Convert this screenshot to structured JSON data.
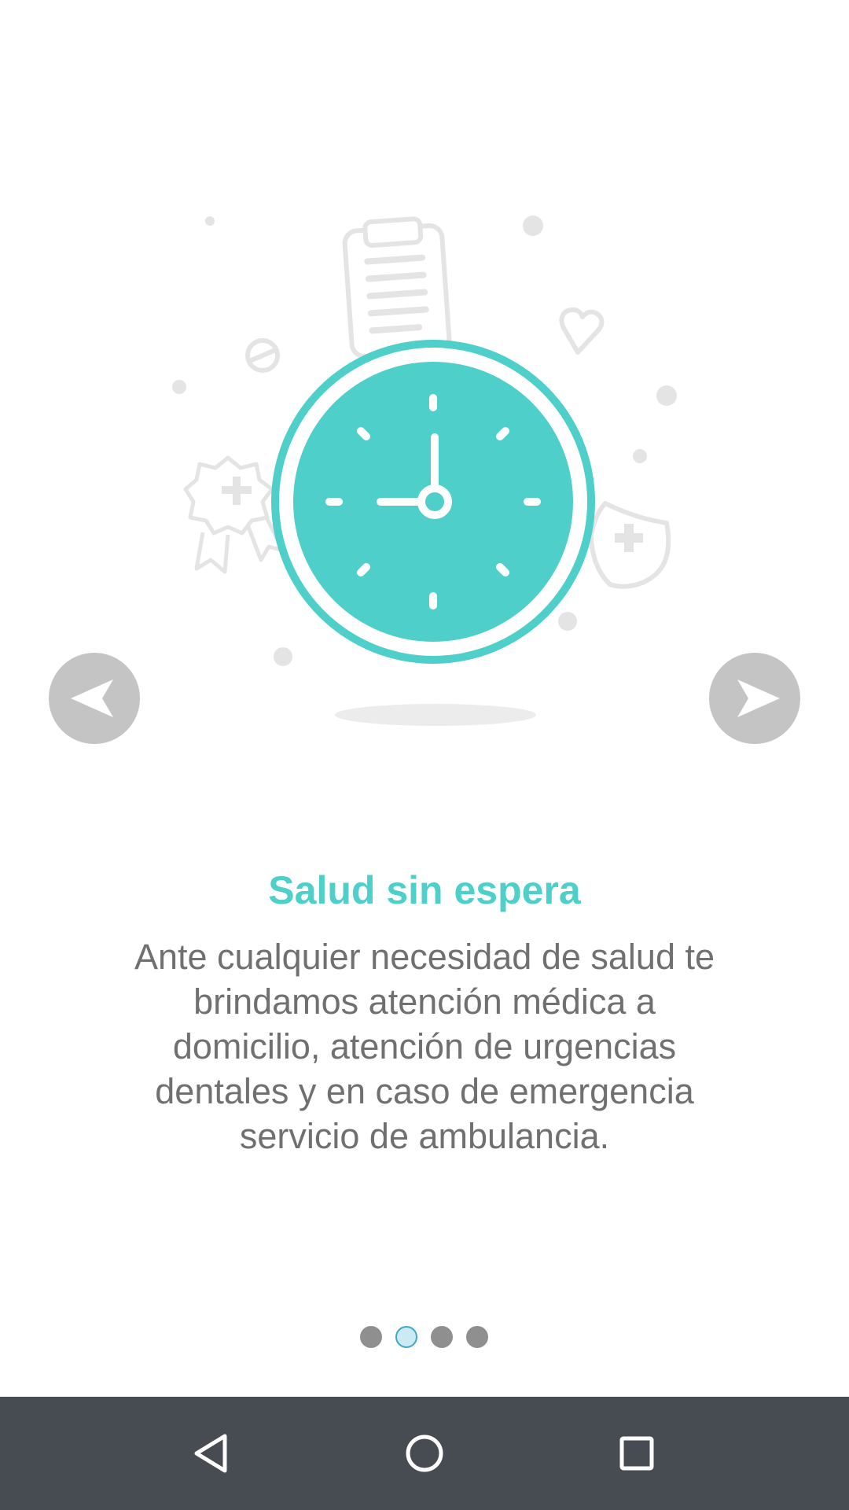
{
  "onboarding": {
    "title": "Salud sin espera",
    "description": "Ante cualquier necesidad de salud te brindamos atención médica a domicilio, atención de urgencias dentales y en caso de emergencia servicio de ambulancia.",
    "current_page": 2,
    "total_pages": 4
  },
  "illustration": {
    "main_icon": "clock-icon",
    "background_icons": [
      "clipboard-icon",
      "pill-icon",
      "heart-icon",
      "award-ribbon-icon",
      "shield-cross-icon"
    ]
  },
  "navigation": {
    "prev_icon": "arrow-left-icon",
    "next_icon": "arrow-right-icon"
  },
  "system_nav": {
    "back_icon": "back-triangle-icon",
    "home_icon": "home-circle-icon",
    "recents_icon": "recents-square-icon"
  },
  "colors": {
    "accent": "#4ecfca",
    "text": "#707070",
    "arrow_bg": "#c4c4c4",
    "nav_bar": "#474c52",
    "dot_inactive": "#8f8f8f",
    "dot_active_fill": "#cde9f3",
    "dot_active_border": "#3aa9c7"
  }
}
